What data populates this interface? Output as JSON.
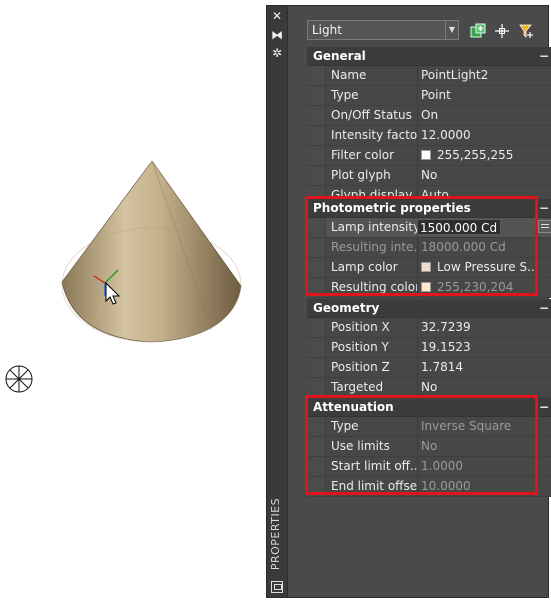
{
  "palette": {
    "vertical_title": "PROPERTIES",
    "object_type": "Light"
  },
  "sections": {
    "general": {
      "title": "General",
      "rows": [
        {
          "label": "Name",
          "value": "PointLight2"
        },
        {
          "label": "Type",
          "value": "Point"
        },
        {
          "label": "On/Off Status",
          "value": "On"
        },
        {
          "label": "Intensity factor",
          "value": "12.0000"
        },
        {
          "label": "Filter color",
          "value": "255,255,255",
          "swatch": "#ffffff"
        },
        {
          "label": "Plot glyph",
          "value": "No"
        },
        {
          "label": "Glyph display",
          "value": "Auto"
        }
      ]
    },
    "photometric": {
      "title": "Photometric properties",
      "rows": [
        {
          "label": "Lamp intensity",
          "value": "1500.000 Cd"
        },
        {
          "label": "Resulting  inte...",
          "value": "18000.000 Cd"
        },
        {
          "label": "Lamp color",
          "value": "Low  Pressure S...",
          "swatch": "#f4ddc8"
        },
        {
          "label": "Resulting color",
          "value": "255,230,204",
          "swatch": "#ffe6cc"
        }
      ]
    },
    "geometry": {
      "title": "Geometry",
      "rows": [
        {
          "label": "Position X",
          "value": "32.7239"
        },
        {
          "label": "Position Y",
          "value": "19.1523"
        },
        {
          "label": "Position Z",
          "value": "1.7814"
        },
        {
          "label": "Targeted",
          "value": "No"
        }
      ]
    },
    "attenuation": {
      "title": "Attenuation",
      "rows": [
        {
          "label": "Type",
          "value": "Inverse Square"
        },
        {
          "label": "Use limits",
          "value": "No"
        },
        {
          "label": "Start limit off...",
          "value": "1.0000"
        },
        {
          "label": "End limit offset",
          "value": "10.0000"
        }
      ]
    }
  },
  "collapse_glyph": "−",
  "colors": {
    "highlight": "#e0141c",
    "panel": "#4a4a4a"
  }
}
